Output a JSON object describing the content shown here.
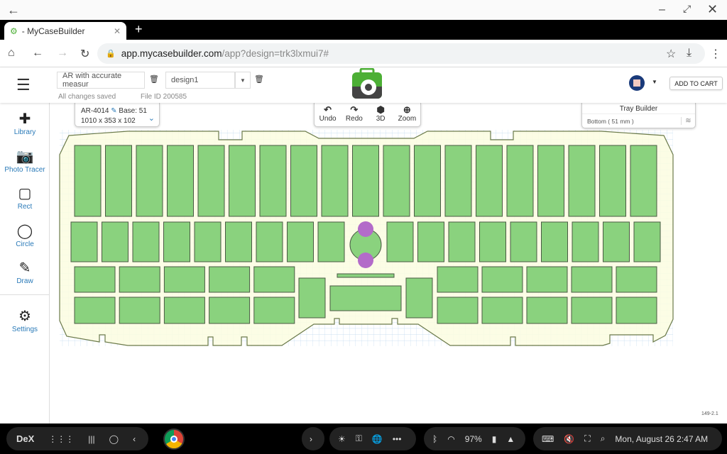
{
  "browser": {
    "tab_title": "- MyCaseBuilder",
    "url_host": "app.mycasebuilder.com",
    "url_path": "/app?design=trk3lxmui7#"
  },
  "header": {
    "project_name": "AR with accurate measur",
    "design_name": "design1",
    "save_status": "All changes saved",
    "file_id": "File ID 200585",
    "add_to_cart": "ADD TO CART"
  },
  "sidebar": {
    "items": [
      {
        "label": "Library",
        "icon": "puzzle-icon"
      },
      {
        "label": "Photo Tracer",
        "icon": "camera-icon"
      },
      {
        "label": "Rect",
        "icon": "square-icon"
      },
      {
        "label": "Circle",
        "icon": "circle-icon"
      },
      {
        "label": "Draw",
        "icon": "pencil-icon"
      },
      {
        "label": "Settings",
        "icon": "gear-icon"
      }
    ]
  },
  "case_info": {
    "model": "AR-4014",
    "base": "Base: 51",
    "dimensions": "1010 x 353 x 102"
  },
  "toolbar": {
    "undo": "Undo",
    "redo": "Redo",
    "view3d": "3D",
    "zoom": "Zoom"
  },
  "tray": {
    "title": "Tray Builder",
    "layer": "Bottom ( 51 mm )"
  },
  "version": "149-2.1",
  "colors": {
    "pocket": "#8ad27e",
    "finger_hole": "#b36bc9",
    "foam": "#fbfde0",
    "brand_green": "#4caf35"
  },
  "taskbar": {
    "dex": "DeX",
    "battery": "97%",
    "datetime": "Mon, August 26 2:47 AM"
  }
}
